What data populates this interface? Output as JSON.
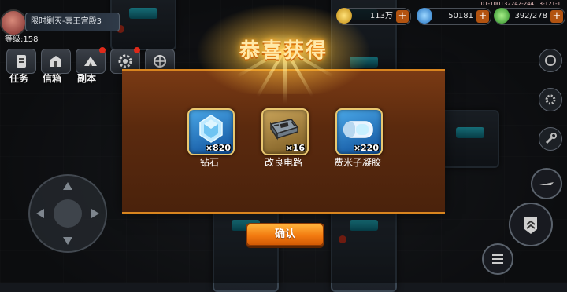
{
  "hud": {
    "event_banner": "限时剿灭-冥王宫殿3",
    "level": "等级:158",
    "server_id": "01-100132242-2441.3-121-1",
    "resources": [
      {
        "icon": "gold-coin-icon",
        "value": "113万",
        "color": "#e0b020"
      },
      {
        "icon": "crystal-icon",
        "value": "50181",
        "color": "#3aa0e8"
      },
      {
        "icon": "energy-icon",
        "value": "392/278",
        "color": "#38c040"
      }
    ],
    "plus_label": "+"
  },
  "nav": {
    "items": [
      {
        "label": "任务",
        "icon": "task-icon"
      },
      {
        "label": "信箱",
        "icon": "mailbox-icon"
      },
      {
        "label": "副本",
        "icon": "dungeon-icon"
      },
      {
        "label": "",
        "icon": "settings-gear-icon"
      },
      {
        "label": "",
        "icon": "globe-icon"
      }
    ]
  },
  "popup": {
    "title": "恭喜获得",
    "rewards": [
      {
        "name": "钻石",
        "count": "×820",
        "icon": "diamond-icon"
      },
      {
        "name": "改良电路",
        "count": "×16",
        "icon": "circuit-board-icon"
      },
      {
        "name": "费米子凝胶",
        "count": "×220",
        "icon": "fermion-gel-icon"
      }
    ],
    "confirm_label": "确认"
  },
  "colors": {
    "accent_orange": "#f27a10",
    "popup_brown": "#5b2a0e",
    "gold_border": "#e9c770",
    "title_glow": "#ffcc40"
  }
}
